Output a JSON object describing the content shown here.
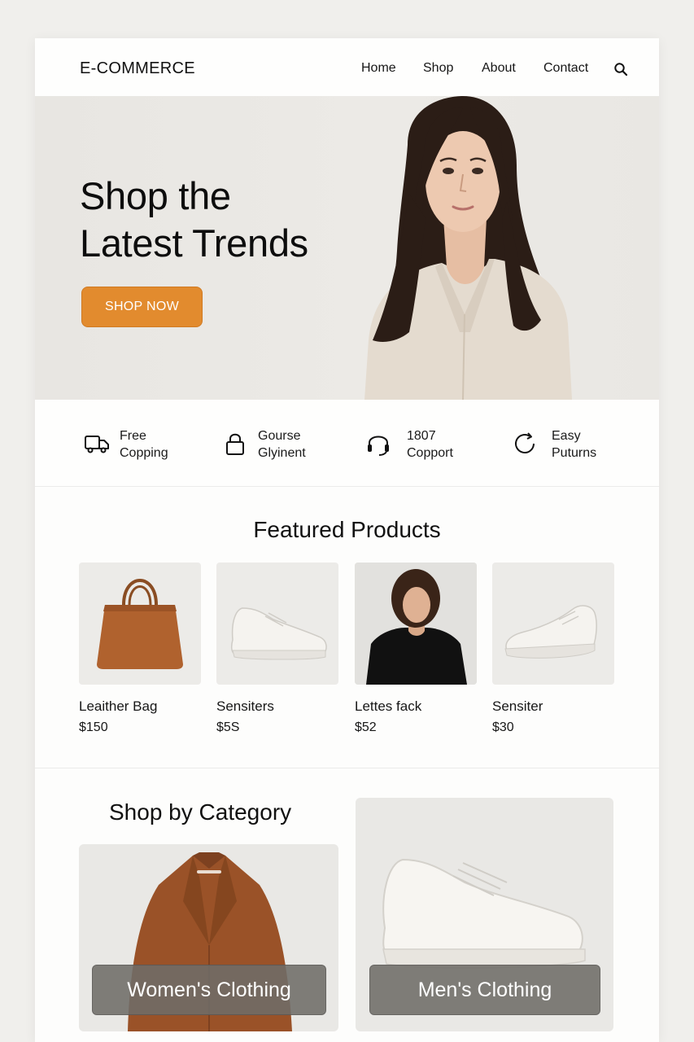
{
  "brand": "E-COMMERCE",
  "nav": {
    "items": [
      {
        "label": "Home"
      },
      {
        "label": "Shop"
      },
      {
        "label": "About"
      },
      {
        "label": "Contact"
      }
    ],
    "search_icon": "search-icon"
  },
  "hero": {
    "title": "Shop the\nLatest Trends",
    "button_label": "SHOP NOW",
    "accent_color": "#e28b2e"
  },
  "features": [
    {
      "icon": "truck-icon",
      "text": "Free\nCopping"
    },
    {
      "icon": "lock-icon",
      "text": "Gourse\nGlyinent"
    },
    {
      "icon": "headset-icon",
      "text": "1807\nCopport"
    },
    {
      "icon": "refresh-icon",
      "text": "Easy\nPuturns"
    }
  ],
  "featured": {
    "title": "Featured Products",
    "products": [
      {
        "name": "Leaither Bag",
        "price": "$150"
      },
      {
        "name": "Sensiters",
        "price": "$5S"
      },
      {
        "name": "Lettes fack",
        "price": "$52"
      },
      {
        "name": "Sensiter",
        "price": "$30"
      }
    ]
  },
  "categories": {
    "title": "Shop by Category",
    "items": [
      {
        "label": "Women's Clothing"
      },
      {
        "label": "Men's Clothing"
      }
    ]
  }
}
